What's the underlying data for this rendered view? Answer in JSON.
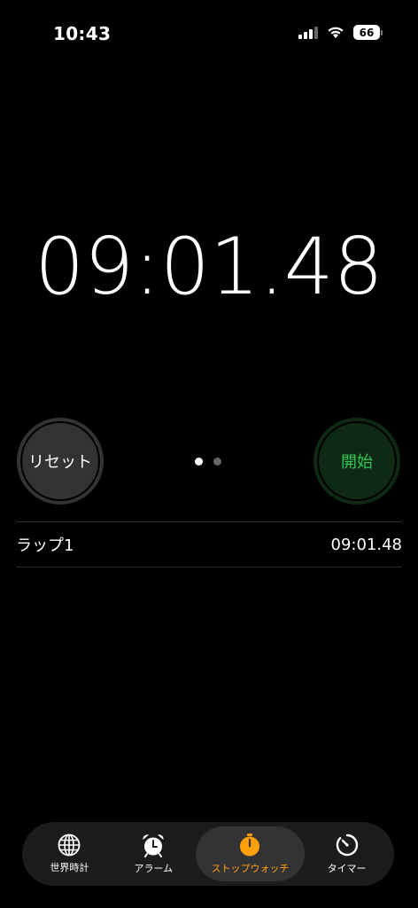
{
  "status_bar": {
    "time": "10:43",
    "battery": "66"
  },
  "stopwatch": {
    "display": "09:01.48"
  },
  "buttons": {
    "reset_label": "リセット",
    "start_label": "開始"
  },
  "laps": [
    {
      "label": "ラップ1",
      "time": "09:01.48"
    }
  ],
  "tabs": [
    {
      "label": "世界時計",
      "icon": "globe-icon",
      "active": false
    },
    {
      "label": "アラーム",
      "icon": "alarm-clock-icon",
      "active": false
    },
    {
      "label": "ストップウォッチ",
      "icon": "stopwatch-icon",
      "active": true
    },
    {
      "label": "タイマー",
      "icon": "timer-icon",
      "active": false
    }
  ],
  "colors": {
    "accent": "#ff9f0a",
    "start_green": "#32c759",
    "start_bg": "#0e2a14",
    "reset_bg": "#333333"
  }
}
